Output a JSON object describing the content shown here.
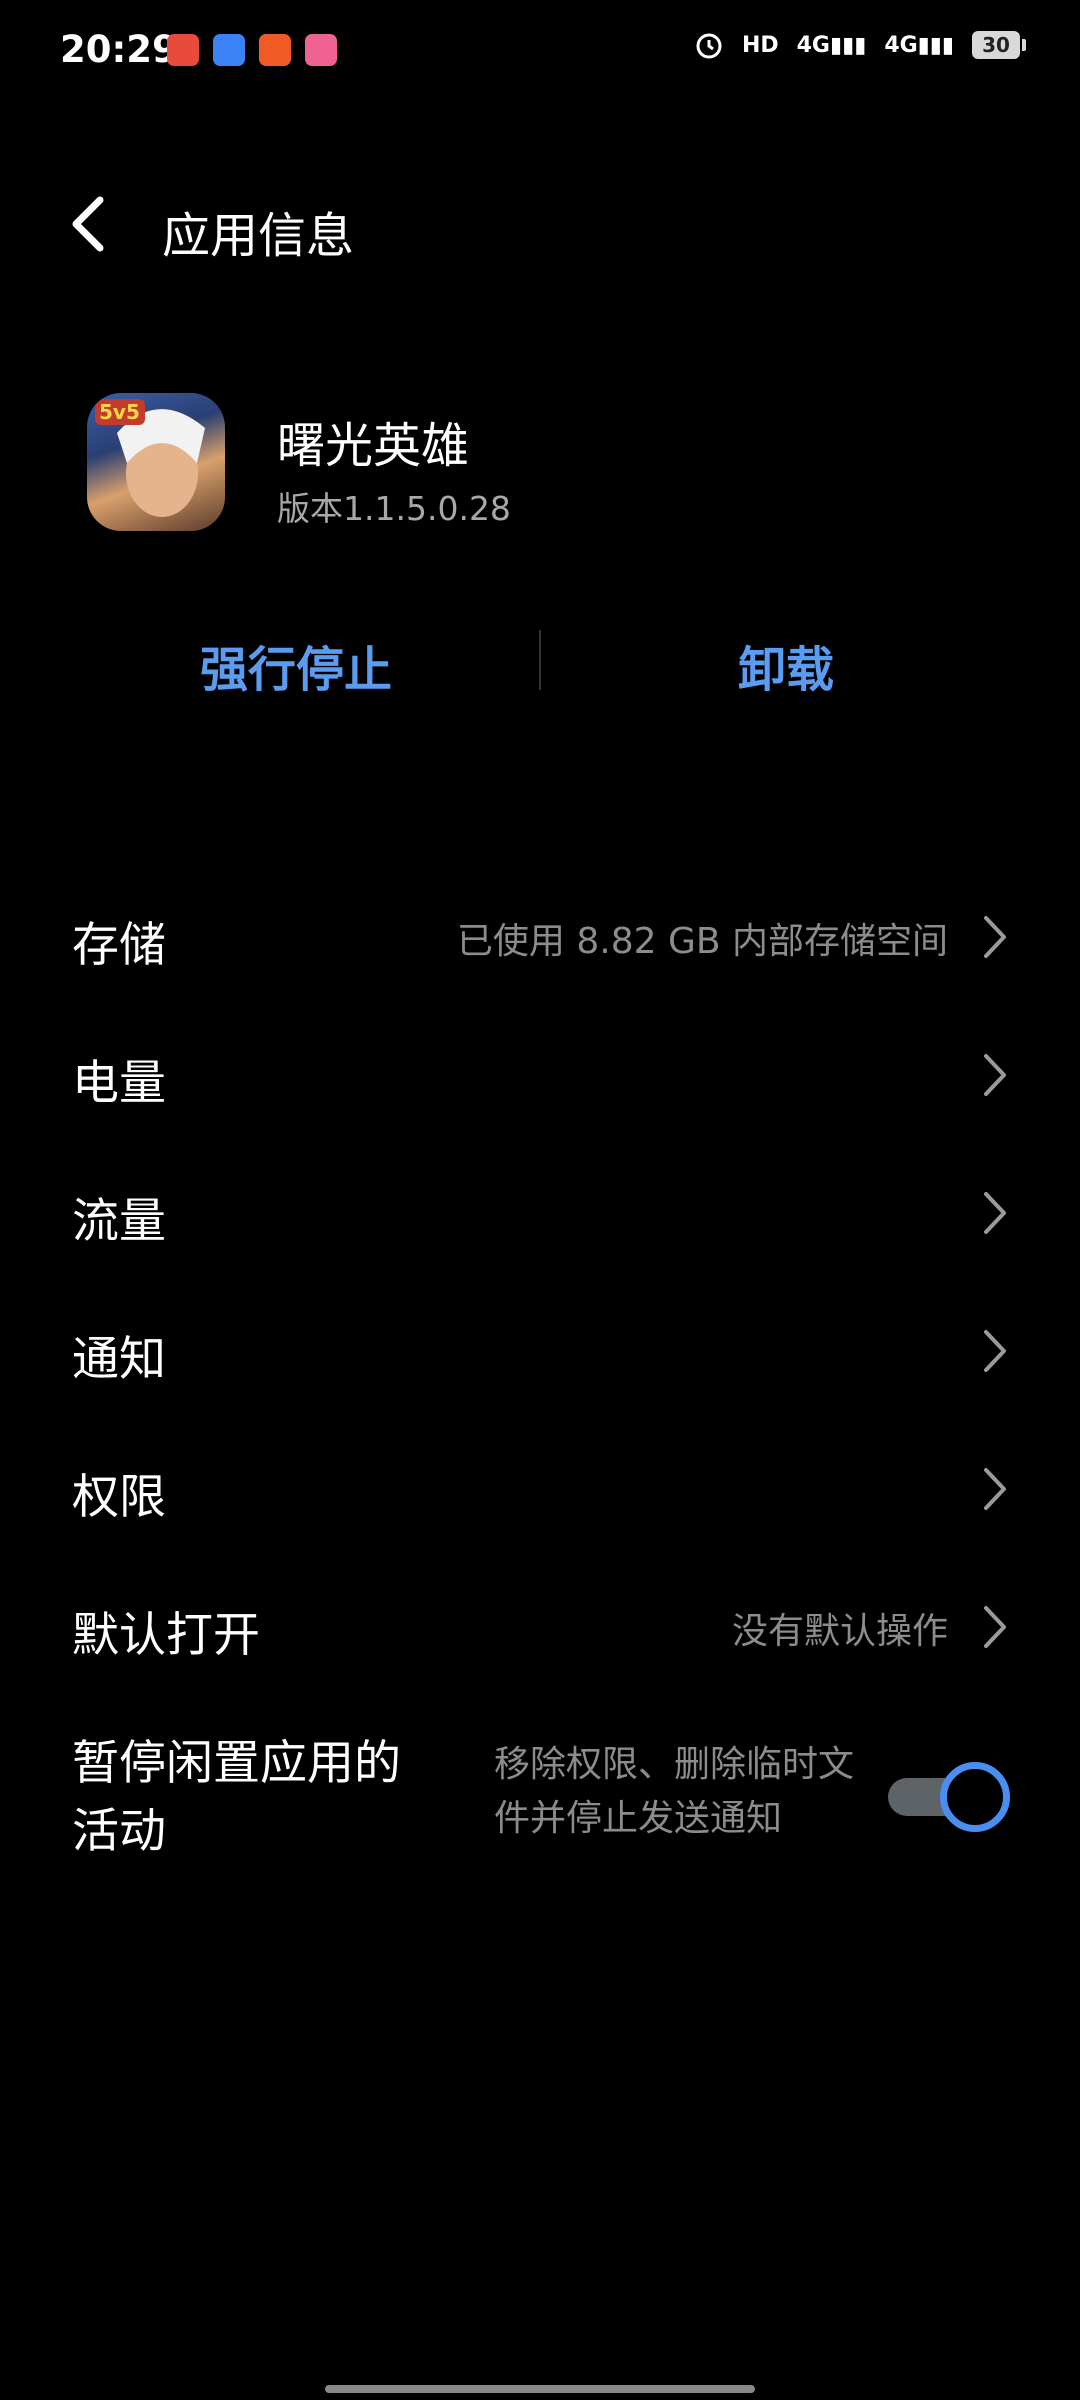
{
  "status_bar": {
    "time": "20:29",
    "notification_icons": [
      "app-notif-1",
      "app-notif-2",
      "app-notif-3",
      "app-notif-4"
    ],
    "system_icons": [
      "alarm-icon",
      "hd-icon",
      "signal-4g-icon",
      "signal-4g-icon"
    ],
    "battery": "30"
  },
  "header": {
    "title": "应用信息"
  },
  "app": {
    "name": "曙光英雄",
    "version": "版本1.1.5.0.28"
  },
  "actions": {
    "force_stop": "强行停止",
    "uninstall": "卸载"
  },
  "settings": {
    "storage": {
      "label": "存储",
      "value": "已使用 8.82 GB 内部存储空间"
    },
    "battery": {
      "label": "电量",
      "value": ""
    },
    "data": {
      "label": "流量",
      "value": ""
    },
    "notifications": {
      "label": "通知",
      "value": ""
    },
    "permissions": {
      "label": "权限",
      "value": ""
    },
    "default_open": {
      "label": "默认打开",
      "value": "没有默认操作"
    },
    "pause_idle": {
      "label": "暂停闲置应用的活动",
      "description": "移除权限、删除临时文件并停止发送通知",
      "enabled": true
    }
  },
  "colors": {
    "accent": "#5a9cf0",
    "background": "#000000"
  }
}
